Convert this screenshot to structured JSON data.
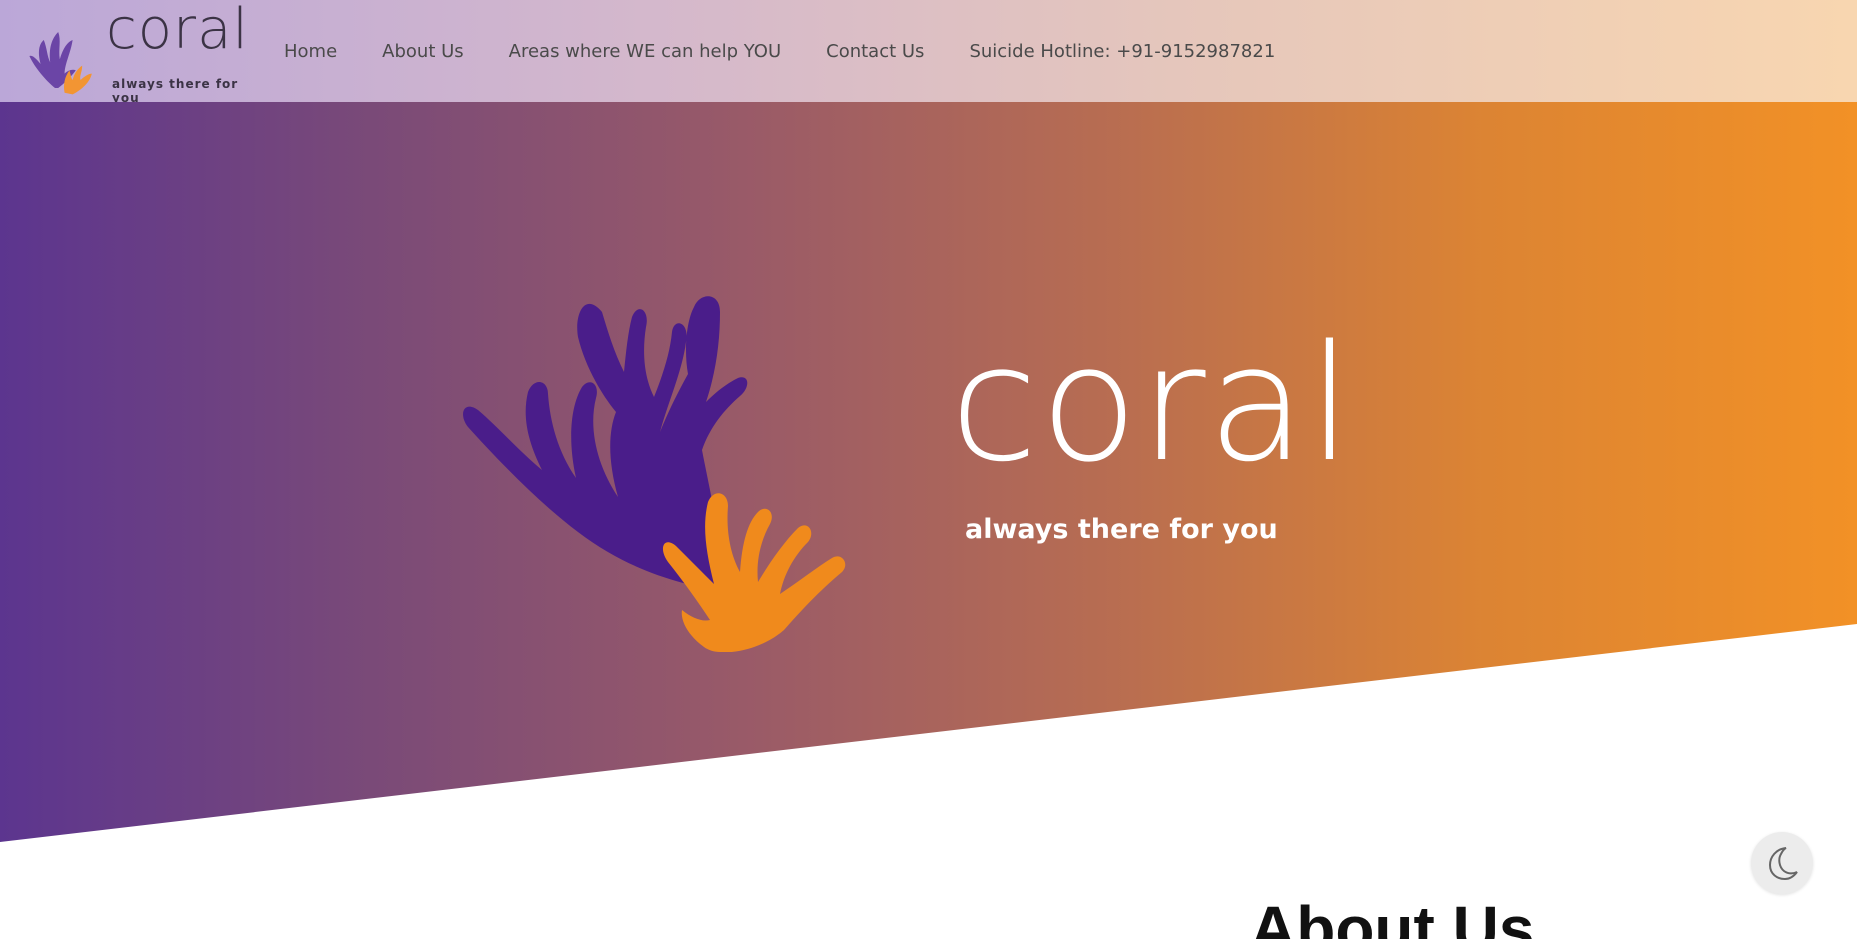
{
  "brand": {
    "name": "coral",
    "tagline": "always there for you"
  },
  "nav": {
    "items": [
      {
        "label": "Home"
      },
      {
        "label": "About Us"
      },
      {
        "label": "Areas where WE can help YOU"
      },
      {
        "label": "Contact Us"
      },
      {
        "label": "Suicide Hotline: +91-9152987821"
      }
    ]
  },
  "hero": {
    "title": "coral",
    "tagline": "always there for you"
  },
  "about": {
    "heading": "About Us"
  },
  "theme_toggle": {
    "icon": "moon-icon"
  },
  "colors": {
    "purple": "#4a1d8a",
    "orange": "#f08a1c",
    "hero_left": "#5c358f",
    "hero_right": "#f29126"
  }
}
